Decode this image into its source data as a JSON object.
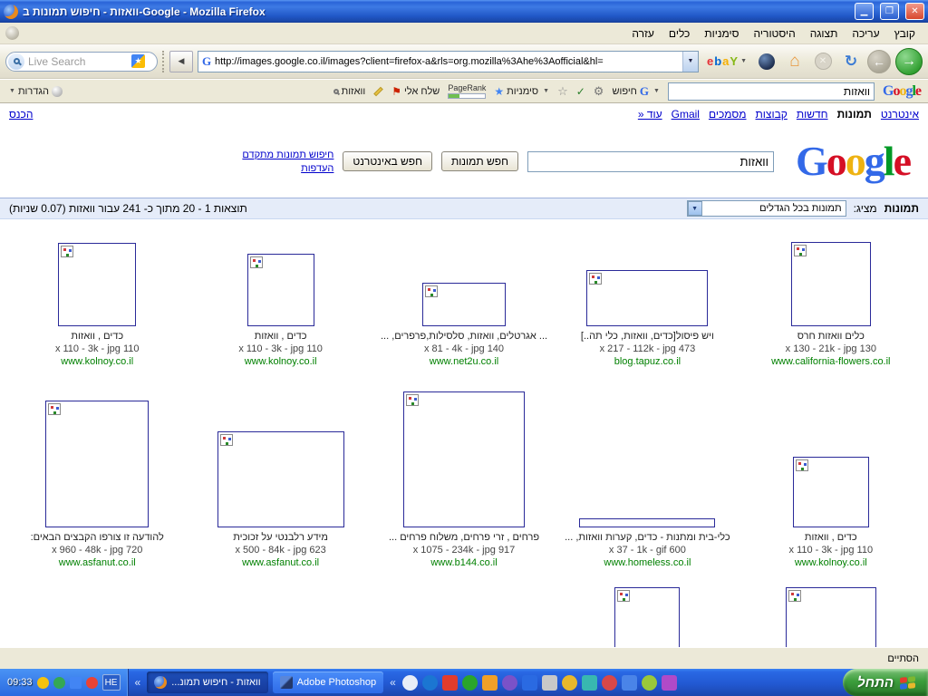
{
  "window": {
    "title": "וואזות - חיפוש תמונות ב-Google - Mozilla Firefox"
  },
  "menubar": {
    "items": [
      "קובץ",
      "עריכה",
      "תצוגה",
      "היסטוריה",
      "סימניות",
      "כלים",
      "עזרה"
    ]
  },
  "navbar": {
    "live_search": "Live Search",
    "url": "http://images.google.co.il/images?client=firefox-a&rls=org.mozilla%3Ahe%3Aofficial&hl=",
    "favicon": "G",
    "ebay_letters": [
      "e",
      "b",
      "a",
      "Y"
    ]
  },
  "gtoolbar": {
    "settings": "הגדרות",
    "highlight": "וואזות",
    "send_to": "שלח אלי",
    "pagerank": "PageRank",
    "bookmarks": "סימניות",
    "search": "חיפוש",
    "g_icon": "G",
    "input_value": "וואזות"
  },
  "page": {
    "logo_letters": [
      "G",
      "o",
      "o",
      "g",
      "l",
      "e"
    ],
    "nav_links": {
      "web": "אינטרנט",
      "images": "תמונות",
      "news": "חדשות",
      "groups": "קבוצות",
      "docs": "מסמכים",
      "gmail": "Gmail",
      "more": "עוד «",
      "signin": "הכנס"
    },
    "search": {
      "value": "וואזות",
      "btn_images": "חפש תמונות",
      "btn_web": "חפש באינטרנט",
      "advanced": "חיפוש תמונות מתקדם",
      "prefs": "העדפות"
    },
    "resultbar": {
      "title": "תמונות",
      "showing": "מציג:",
      "size_filter": "תמונות בכל הגדלים",
      "stats": "תוצאות 1 - 20 מתוך כ- 241 עבור וואזות (0.07 שניות)"
    },
    "results_row1": [
      {
        "caption": "כלים וואזות חרס",
        "dims": "130 x 130 - 21k - jpg",
        "url": "www.california-flowers.co.il"
      },
      {
        "caption": "ויש פיסול[כדים, וואזות, כלי תה..]",
        "dims": "473 x 217 - 112k - jpg",
        "url": "blog.tapuz.co.il"
      },
      {
        "caption": "... אגרטלים, וואזות, סלסילות,פרפרים, ...",
        "dims": "140 x 81 - 4k - jpg",
        "url": "www.net2u.co.il"
      },
      {
        "caption": "כדים , וואזות",
        "dims": "110 x 110 - 3k - jpg",
        "url": "www.kolnoy.co.il"
      },
      {
        "caption": "כדים , וואזות",
        "dims": "110 x 110 - 3k - jpg",
        "url": "www.kolnoy.co.il"
      }
    ],
    "results_row2": [
      {
        "caption": "כדים , וואזות",
        "dims": "110 x 110 - 3k - jpg",
        "url": "www.kolnoy.co.il"
      },
      {
        "caption": "כלי-בית ומתנות - כדים, קערות וואזות, ...",
        "dims": "600 x 37 - 1k - gif",
        "url": "www.homeless.co.il"
      },
      {
        "caption": "פרחים , זרי פרחים, משלוח פרחים ...",
        "dims": "917 x 1075 - 234k - jpg",
        "url": "www.b144.co.il"
      },
      {
        "caption": "מידע רלבנטי על זכוכית",
        "dims": "623 x 500 - 84k - jpg",
        "url": "www.asfanut.co.il"
      },
      {
        "caption": "להודעה זו צורפו הקבצים הבאים:",
        "dims": "720 x 960 - 48k - jpg",
        "url": "www.asfanut.co.il"
      }
    ]
  },
  "statusbar": {
    "text": "הסתיים"
  },
  "taskbar": {
    "start": "התחל",
    "clock": "09:33",
    "lang": "HE",
    "buttons": [
      {
        "label": "וואזות - חיפוש תמונ..."
      },
      {
        "label": "Adobe Photoshop"
      }
    ]
  }
}
